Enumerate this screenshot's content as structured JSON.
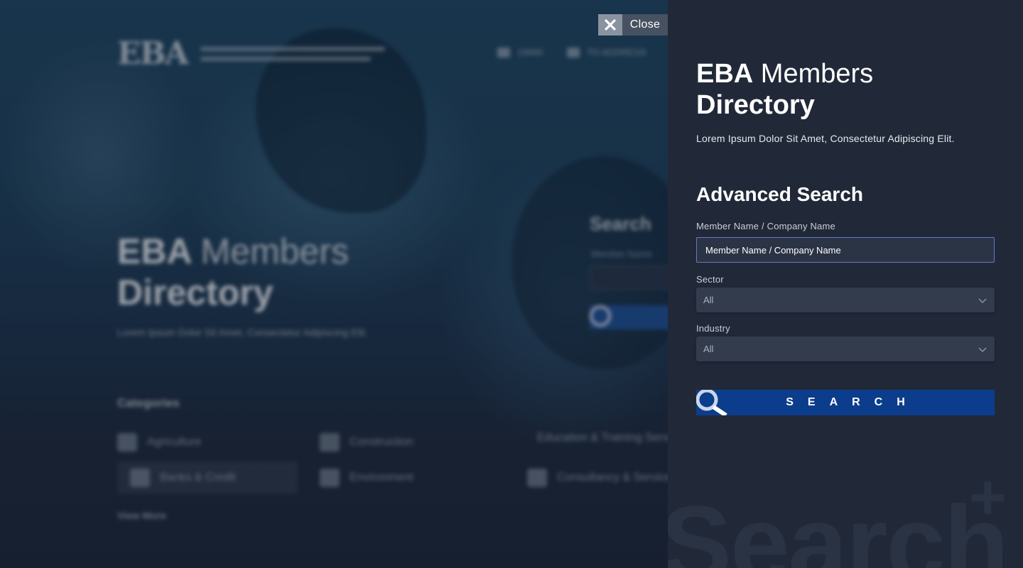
{
  "background": {
    "logo": {
      "mark": "EBA"
    },
    "contacts": [
      {
        "icon": "phone-icon",
        "text": "19990"
      },
      {
        "icon": "mail-icon",
        "text": "TO ADDRESS"
      }
    ],
    "hero": {
      "title_bold": "EBA",
      "title_light": "Members",
      "title_line2": "Directory",
      "subtitle": "Lorem Ipsum Dolor Sit Amet, Consectetur Adipiscing Elit."
    },
    "search": {
      "title": "Search",
      "label": "Member Name",
      "placeholder": "Member Name"
    },
    "categories": {
      "title": "Categories",
      "items": [
        {
          "label": "Agriculture",
          "icon": "leaf-icon"
        },
        {
          "label": "Construction",
          "icon": "building-icon"
        },
        {
          "label": "Education & Training Services",
          "icon": "book-icon"
        },
        {
          "label": "Banks & Credit",
          "icon": "bank-icon"
        },
        {
          "label": "Environment",
          "icon": "environment-icon"
        },
        {
          "label": "Consultancy & Services",
          "icon": "briefcase-icon"
        }
      ],
      "view_more": "View More"
    }
  },
  "close": {
    "label": "Close",
    "icon": "close-icon"
  },
  "panel": {
    "title_bold": "EBA",
    "title_light": "Members",
    "title_line2": "Directory",
    "subtitle": "Lorem Ipsum Dolor Sit Amet, Consectetur Adipiscing Elit.",
    "advanced_search": "Advanced Search",
    "member_field": {
      "label": "Member Name / Company Name",
      "value": "Member Name / Company Name"
    },
    "sector_field": {
      "label": "Sector",
      "value": "All"
    },
    "industry_field": {
      "label": "Industry",
      "value": "All"
    },
    "search_button": "SEARCH",
    "watermark": "Search",
    "watermark_plus": "+"
  },
  "colors": {
    "panel_bg": "#212939",
    "accent": "#0c3d8c",
    "input_border": "#6a78c8"
  }
}
